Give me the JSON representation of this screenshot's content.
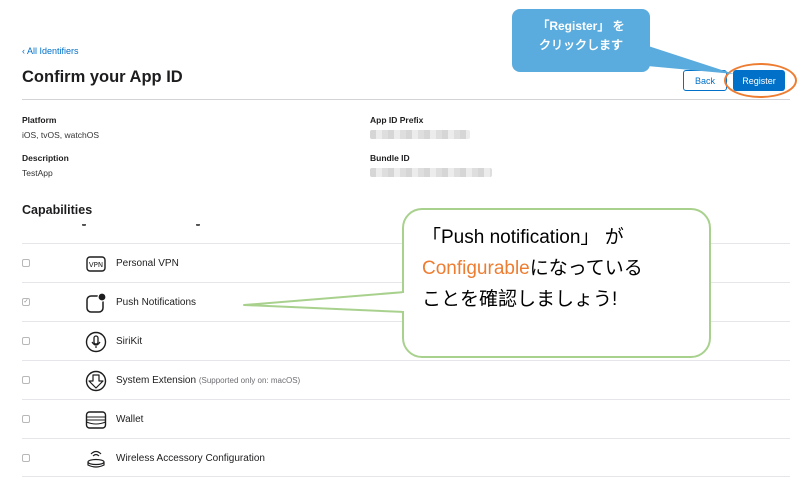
{
  "nav": {
    "back_link": "‹ All Identifiers"
  },
  "header": {
    "title": "Confirm your App ID",
    "back_button": "Back",
    "register_button": "Register"
  },
  "details": {
    "platform_label": "Platform",
    "platform_value": "iOS, tvOS, watchOS",
    "prefix_label": "App ID Prefix",
    "description_label": "Description",
    "description_value": "TestApp",
    "bundle_label": "Bundle ID"
  },
  "capabilities": {
    "title": "Capabilities",
    "items": [
      {
        "label": "Personal VPN",
        "checked": false,
        "icon": "vpn-icon"
      },
      {
        "label": "Push Notifications",
        "checked": true,
        "icon": "push-notification-icon"
      },
      {
        "label": "SiriKit",
        "checked": false,
        "icon": "siri-icon"
      },
      {
        "label": "System Extension",
        "note": "(Supported only on: macOS)",
        "checked": false,
        "icon": "system-extension-icon"
      },
      {
        "label": "Wallet",
        "checked": false,
        "icon": "wallet-icon"
      },
      {
        "label": "Wireless Accessory Configuration",
        "checked": false,
        "icon": "wireless-accessory-icon"
      }
    ]
  },
  "annotations": {
    "register_callout_line1": "「Register」 を",
    "register_callout_line2": "クリックします",
    "push_callout_line1": "「Push notification」 が",
    "push_callout_orange": "Configurable",
    "push_callout_line2_rest": "になっている",
    "push_callout_line3": "ことを確認しましょう!"
  },
  "colors": {
    "accent": "#0070c9",
    "highlight": "#ee7d31",
    "callout_blue": "#5aacde",
    "callout_green_border": "#a9d18e"
  }
}
